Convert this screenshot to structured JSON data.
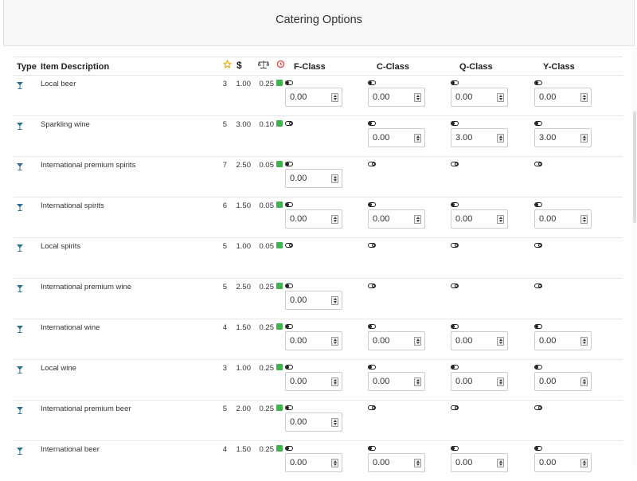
{
  "title": "Catering Options",
  "headers": {
    "type": "Type",
    "item": "Item Description",
    "f": "F-Class",
    "c": "C-Class",
    "q": "Q-Class",
    "y": "Y-Class"
  },
  "icons": {
    "rating": "star-icon",
    "price": "dollar-icon",
    "weight": "balance-scale-icon",
    "time": "clock-icon",
    "type": "glass-icon",
    "excel": "excel-icon"
  },
  "colors": {
    "star": "#e0a800",
    "clock": "#d9534f",
    "glass": "#2d6f8e",
    "excel": "#3fb34f"
  },
  "items": [
    {
      "desc": "Local beer",
      "rating": "3",
      "price": "1.00",
      "weight": "0.25",
      "f": {
        "on": true,
        "value": "0.00"
      },
      "c": {
        "on": true,
        "value": "0.00"
      },
      "q": {
        "on": true,
        "value": "0.00"
      },
      "y": {
        "on": true,
        "value": "0.00"
      }
    },
    {
      "desc": "Sparkling wine",
      "rating": "5",
      "price": "3.00",
      "weight": "0.10",
      "f": {
        "on": false
      },
      "c": {
        "on": true,
        "value": "0.00"
      },
      "q": {
        "on": true,
        "value": "3.00"
      },
      "y": {
        "on": true,
        "value": "3.00"
      }
    },
    {
      "desc": "International premium spirits",
      "rating": "7",
      "price": "2.50",
      "weight": "0.05",
      "f": {
        "on": true,
        "value": "0.00"
      },
      "c": {
        "on": false
      },
      "q": {
        "on": false
      },
      "y": {
        "on": false
      }
    },
    {
      "desc": "International spirits",
      "rating": "6",
      "price": "1.50",
      "weight": "0.05",
      "f": {
        "on": true,
        "value": "0.00"
      },
      "c": {
        "on": true,
        "value": "0.00"
      },
      "q": {
        "on": true,
        "value": "0.00"
      },
      "y": {
        "on": true,
        "value": "0.00"
      }
    },
    {
      "desc": "Local spirits",
      "rating": "5",
      "price": "1.00",
      "weight": "0.05",
      "f": {
        "on": false
      },
      "c": {
        "on": false
      },
      "q": {
        "on": false
      },
      "y": {
        "on": false
      }
    },
    {
      "desc": "International premium wine",
      "rating": "5",
      "price": "2.50",
      "weight": "0.25",
      "f": {
        "on": true,
        "value": "0.00"
      },
      "c": {
        "on": false
      },
      "q": {
        "on": false
      },
      "y": {
        "on": false
      }
    },
    {
      "desc": "International wine",
      "rating": "4",
      "price": "1.50",
      "weight": "0.25",
      "f": {
        "on": true,
        "value": "0.00"
      },
      "c": {
        "on": true,
        "value": "0.00"
      },
      "q": {
        "on": true,
        "value": "0.00"
      },
      "y": {
        "on": true,
        "value": "0.00"
      }
    },
    {
      "desc": "Local wine",
      "rating": "3",
      "price": "1.00",
      "weight": "0.25",
      "f": {
        "on": true,
        "value": "0.00"
      },
      "c": {
        "on": true,
        "value": "0.00"
      },
      "q": {
        "on": true,
        "value": "0.00"
      },
      "y": {
        "on": true,
        "value": "0.00"
      }
    },
    {
      "desc": "International premium beer",
      "rating": "5",
      "price": "2.00",
      "weight": "0.25",
      "f": {
        "on": true,
        "value": "0.00"
      },
      "c": {
        "on": false
      },
      "q": {
        "on": false
      },
      "y": {
        "on": false
      }
    },
    {
      "desc": "International beer",
      "rating": "4",
      "price": "1.50",
      "weight": "0.25",
      "f": {
        "on": true,
        "value": "0.00"
      },
      "c": {
        "on": true,
        "value": "0.00"
      },
      "q": {
        "on": true,
        "value": "0.00"
      },
      "y": {
        "on": true,
        "value": "0.00"
      }
    }
  ]
}
